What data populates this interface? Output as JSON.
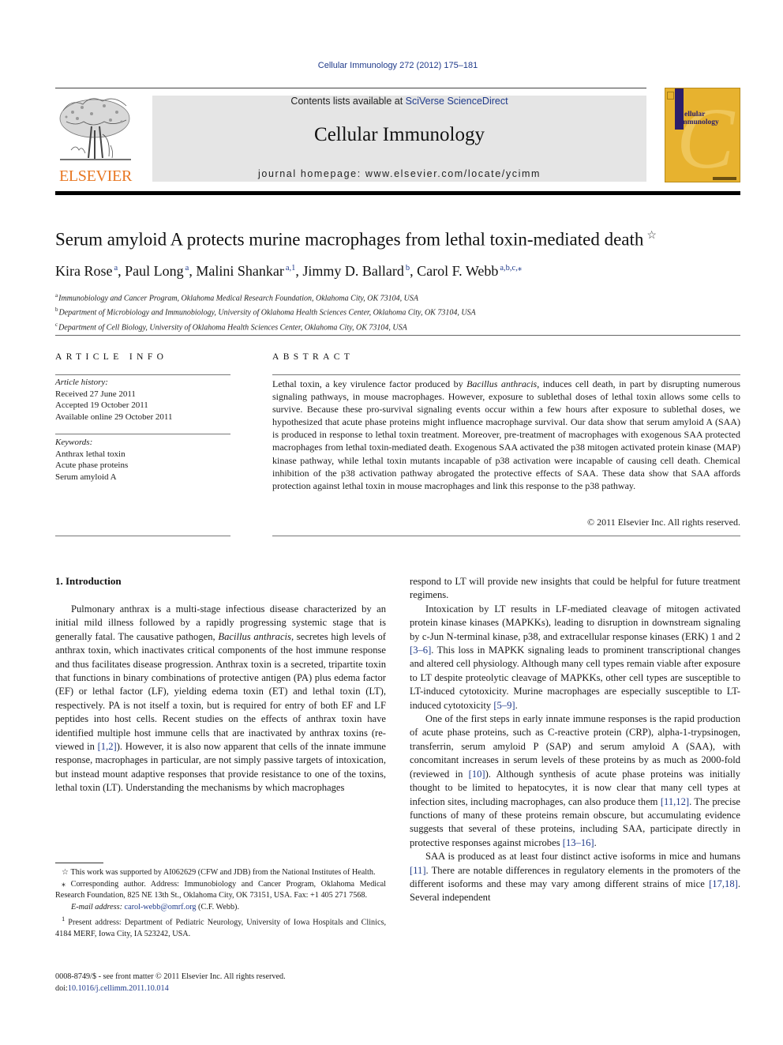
{
  "citation": "Cellular Immunology 272 (2012) 175–181",
  "publisher": {
    "logo_word": "ELSEVIER",
    "brand_color": "#e87722"
  },
  "masthead": {
    "contents_prefix": "Contents lists available at ",
    "contents_link": "SciVerse ScienceDirect",
    "journal_name": "Cellular Immunology",
    "homepage": "journal homepage: www.elsevier.com/locate/ycimm"
  },
  "cover": {
    "title_line1": "ellular",
    "title_line2": "Immunology",
    "big_letter": "C",
    "color": "#e7b22f"
  },
  "article": {
    "title": "Serum amyloid A protects murine macrophages from lethal toxin-mediated death",
    "title_mark": "☆",
    "authors": [
      {
        "name": "Kira Rose",
        "sup": "a",
        "sep": ", "
      },
      {
        "name": "Paul Long",
        "sup": "a",
        "sep": ", "
      },
      {
        "name": "Malini Shankar",
        "sup": "a,1",
        "sep": ", "
      },
      {
        "name": "Jimmy D. Ballard",
        "sup": "b",
        "sep": ", "
      },
      {
        "name": "Carol F. Webb",
        "sup": "a,b,c,⁎",
        "sep": ""
      }
    ],
    "affiliations": [
      {
        "key": "a",
        "text": "Immunobiology and Cancer Program, Oklahoma Medical Research Foundation, Oklahoma City, OK 73104, USA"
      },
      {
        "key": "b",
        "text": "Department of Microbiology and Immunobiology, University of Oklahoma Health Sciences Center, Oklahoma City, OK 73104, USA"
      },
      {
        "key": "c",
        "text": "Department of Cell Biology, University of Oklahoma Health Sciences Center, Oklahoma City, OK 73104, USA"
      }
    ]
  },
  "article_info": {
    "heading": "ARTICLE INFO",
    "history_label": "Article history:",
    "history": [
      "Received 27 June 2011",
      "Accepted 19 October 2011",
      "Available online 29 October 2011"
    ],
    "keywords_label": "Keywords:",
    "keywords": [
      "Anthrax lethal toxin",
      "Acute phase proteins",
      "Serum amyloid A"
    ]
  },
  "abstract": {
    "heading": "ABSTRACT",
    "part1": "Lethal toxin, a key virulence factor produced by ",
    "organism": "Bacillus anthracis",
    "part2": ", induces cell death, in part by disrupting numerous signaling pathways, in mouse macrophages. However, exposure to sublethal doses of lethal toxin allows some cells to survive. Because these pro-survival signaling events occur within a few hours after exposure to sublethal doses, we hypothesized that acute phase proteins might influence macro­phage survival. Our data show that serum amyloid A (SAA) is produced in response to lethal toxin treat­ment. Moreover, pre-treatment of macrophages with exogenous SAA protected macrophages from lethal toxin-mediated death. Exogenous SAA activated the p38 mitogen activated protein kinase (MAP) kinase pathway, while lethal toxin mutants incapable of p38 activation were incapable of causing cell death. Chemical inhibition of the p38 activation pathway abrogated the protective effects of SAA. These data show that SAA affords protection against lethal toxin in mouse macrophages and link this response to the p38 pathway.",
    "copyright": "© 2011 Elsevier Inc. All rights reserved."
  },
  "body": {
    "section_heading": "1. Introduction",
    "left_para": {
      "s1": "Pulmonary anthrax is a multi-stage infectious disease charac­terized by an initial mild illness followed by a rapidly progressing systemic stage that is generally fatal. The causative pathogen, ",
      "organism": "Bacillus anthracis",
      "s2": ", secretes high levels of anthrax toxin, which inac­tivates critical components of the host immune response and thus facilitates disease progression. Anthrax toxin is a secreted, tripar­tite toxin that functions in binary combinations of protective anti­gen (PA) plus edema factor (EF) or lethal factor (LF), yielding edema toxin (ET) and lethal toxin (LT), respectively. PA is not itself a toxin, but is required for entry of both EF and LF peptides into host cells. Recent studies on the effects of anthrax toxin have identified mul­tiple host immune cells that are inactivated by anthrax toxins (re­viewed in ",
      "ref1": "[1,2]",
      "s3": "). However, it is also now apparent that cells of the innate immune response, macrophages in particular, are not simply passive targets of intoxication, but instead mount adaptive responses that provide resistance to one of the toxins, lethal toxin (LT). Understanding the mechanisms by which macrophages"
    },
    "right_continuation": "respond to LT will provide new insights that could be helpful for future treatment regimens.",
    "para2": {
      "s1": "Intoxication by LT results in LF-mediated cleavage of mitogen activated protein kinase kinases (MAPKKs), leading to disruption in downstream signaling by c-Jun N-terminal kinase, p38, and extracellular response kinases (ERK) 1 and 2 ",
      "ref1": "[3–6]",
      "s2": ". This loss in MAPKK signaling leads to prominent transcriptional changes and altered cell physiology. Although many cell types remain viable after exposure to LT despite proteolytic cleavage of MAPKKs, other cell types are susceptible to LT-induced cytotoxicity. Murine macrophages are especially susceptible to LT-induced cytotoxicity ",
      "ref2": "[5–9]",
      "s3": "."
    },
    "para3": {
      "s1": "One of the first steps in early innate immune responses is the rapid production of acute phase proteins, such as C-reactive pro­tein (CRP), alpha-1-trypsinogen, transferrin, serum amyloid P (SAP) and serum amyloid A (SAA), with concomitant increases in serum levels of these proteins by as much as 2000-fold (reviewed in ",
      "ref1": "[10]",
      "s2": "). Although synthesis of acute phase proteins was initially thought to be limited to hepatocytes, it is now clear that many cell types at infection sites, including macrophages, can also produce them ",
      "ref2": "[11,12]",
      "s3": ". The precise functions of many of these proteins re­main obscure, but accumulating evidence suggests that several of these proteins, including SAA, participate directly in protective re­sponses against microbes ",
      "ref3": "[13–16]",
      "s4": "."
    },
    "para4": {
      "s1": "SAA is produced as at least four distinct active isoforms in mice and humans ",
      "ref1": "[11]",
      "s2": ". There are notable differences in regulatory ele­ments in the promoters of the different isoforms and these may vary among different strains of mice ",
      "ref2": "[17,18]",
      "s3": ". Several independent"
    }
  },
  "footnotes": {
    "funding": "☆ This work was supported by AI062629 (CFW and JDB) from the National Institutes of Health.",
    "corresponding": "⁎ Corresponding author. Address: Immunobiology and Cancer Program, Oklahoma Medical Research Foundation, 825 NE 13th St., Oklahoma City, OK 73151, USA. Fax: +1 405 271 7568.",
    "email_label": "E-mail address: ",
    "email": "carol-webb@omrf.org",
    "email_suffix": " (C.F. Webb).",
    "present_address_mark": "1",
    "present_address": " Present address: Department of Pediatric Neurology, University of Iowa Hospitals and Clinics, 4184 MERF, Iowa City, IA 523242, USA."
  },
  "front_matter": {
    "issn_line": "0008-8749/$ - see front matter © 2011 Elsevier Inc. All rights reserved.",
    "doi_prefix": "doi:",
    "doi": "10.1016/j.cellimm.2011.10.014"
  }
}
